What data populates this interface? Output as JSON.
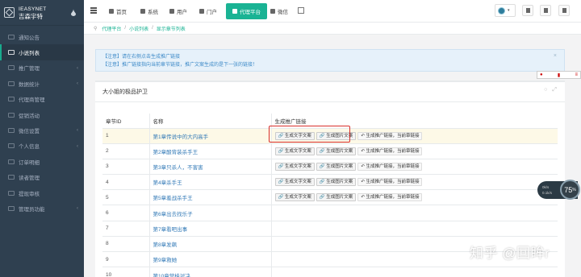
{
  "brand": {
    "en": "IEASYNET",
    "cn": "吉森宇特"
  },
  "sidebar": {
    "items": [
      {
        "label": "通知公告"
      },
      {
        "label": "小说列表",
        "active": true
      },
      {
        "label": "推广管理",
        "arrow": "‹"
      },
      {
        "label": "数据统计",
        "arrow": "‹"
      },
      {
        "label": "代理商管理"
      },
      {
        "label": "促销活动"
      },
      {
        "label": "微信设置",
        "arrow": "‹"
      },
      {
        "label": "个人信息",
        "arrow": "‹"
      },
      {
        "label": "订单明细"
      },
      {
        "label": "读者管理"
      },
      {
        "label": "提现审核"
      },
      {
        "label": "管理员功能",
        "arrow": "‹"
      }
    ]
  },
  "topnav": {
    "items": [
      {
        "label": "首页"
      },
      {
        "label": "系统"
      },
      {
        "label": "用户"
      },
      {
        "label": "门户"
      },
      {
        "label": "代理平台",
        "active": true
      },
      {
        "label": "微信"
      }
    ]
  },
  "breadcrumb": {
    "items": [
      "代理平台",
      "小说列表",
      "显示章节列表"
    ]
  },
  "alert": {
    "line1": "【注意】请在右侧点击生成推广链接",
    "line2": "【注意】推广链接指向当前章节链接，推广文案生成的是下一张的链接！",
    "close": "×"
  },
  "panel": {
    "title": "大小姐的极品护卫",
    "headers": {
      "id": "章节ID",
      "name": "名称",
      "action": "生成推广链接"
    },
    "btn_text": "生成文字文案",
    "btn_image": "生成图片文案",
    "btn_link": "生成推广链接，当前章链接",
    "rows": [
      {
        "id": "1",
        "name": "第1章传说中的大内高手",
        "actions": true,
        "highlight": true
      },
      {
        "id": "2",
        "name": "第2章酸背装杀手王",
        "actions": true
      },
      {
        "id": "3",
        "name": "第3章只杀人，不害害",
        "actions": true
      },
      {
        "id": "4",
        "name": "第4章杀手王",
        "actions": true
      },
      {
        "id": "5",
        "name": "第5章羞战杀手王",
        "actions": true
      },
      {
        "id": "6",
        "name": "第6章出去找乐子",
        "actions": false
      },
      {
        "id": "7",
        "name": "第7章看吧出事",
        "actions": false
      },
      {
        "id": "8",
        "name": "第8章发飙",
        "actions": false
      },
      {
        "id": "9",
        "name": "第9章救她",
        "actions": false
      },
      {
        "id": "10",
        "name": "第10章营桂对决",
        "actions": false
      }
    ]
  },
  "widgets": {
    "speed_up": "0k/s",
    "speed_down": "0.1k/s",
    "gauge": "75",
    "gauge_unit": "%"
  },
  "watermark": "知乎 @回眸r"
}
